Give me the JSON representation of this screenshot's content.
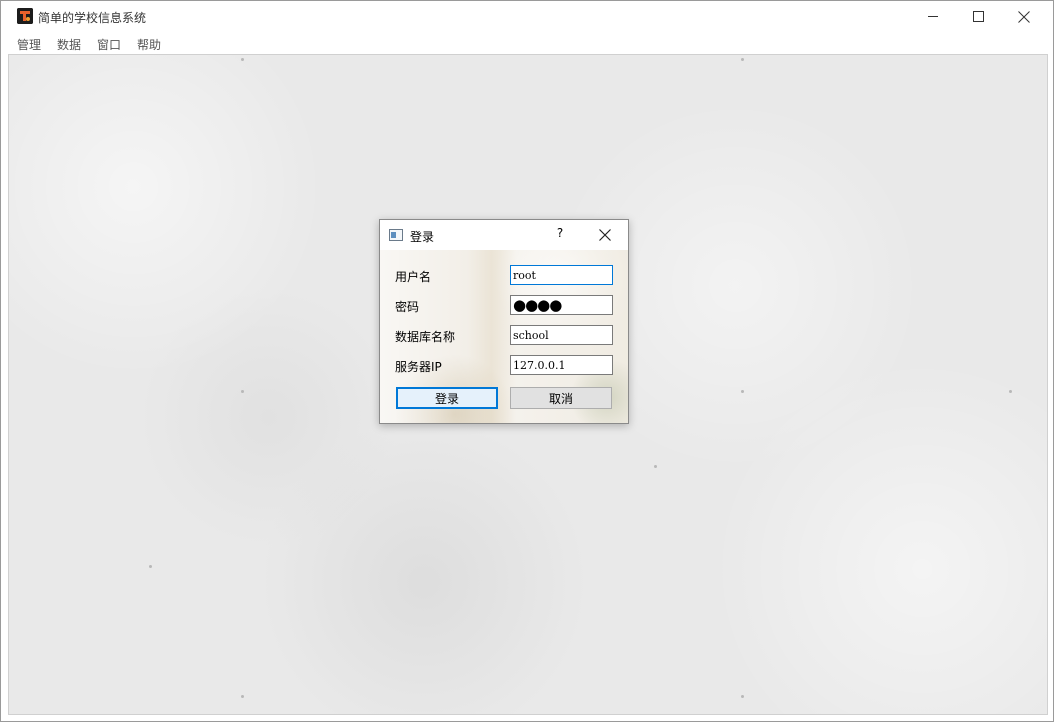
{
  "window": {
    "title": "简单的学校信息系统",
    "icon": "app-logo-icon"
  },
  "menu": {
    "items": [
      "管理",
      "数据",
      "窗口",
      "帮助"
    ]
  },
  "dialog": {
    "title": "登录",
    "help_label": "?",
    "fields": {
      "username": {
        "label": "用户名",
        "value": "root"
      },
      "password": {
        "label": "密码",
        "value": "●●●●"
      },
      "database": {
        "label": "数据库名称",
        "value": "school"
      },
      "server": {
        "label": "服务器IP",
        "value": "127.0.0.1"
      }
    },
    "login_button": "登录",
    "cancel_button": "取消"
  },
  "colors": {
    "focus_accent": "#0078d7",
    "mdi_background": "#e9e9e9"
  }
}
